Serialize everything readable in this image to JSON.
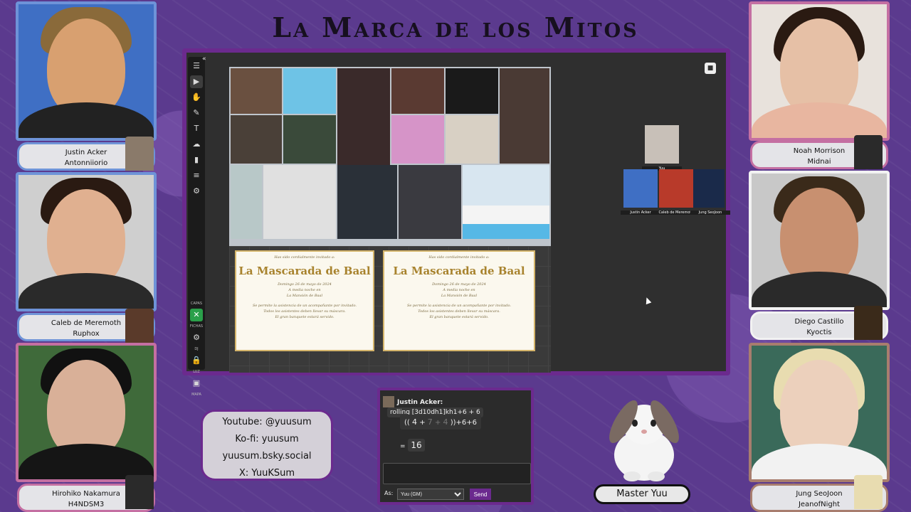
{
  "title": "La Marca de los Mitos",
  "players": [
    {
      "name": "Justin Acker",
      "handle": "Antonniiorio"
    },
    {
      "name": "Caleb de Meremoth",
      "handle": "Ruphox"
    },
    {
      "name": "Hirohiko Nakamura",
      "handle": "H4NDSM3"
    },
    {
      "name": "Noah Morrison",
      "handle": "Midnai"
    },
    {
      "name": "Diego Castillo",
      "handle": "Kyoctis"
    },
    {
      "name": "Jung SeoJoon",
      "handle": "JeanofNight"
    }
  ],
  "toolbar": {
    "labels": [
      "CAPAS",
      "FICHAS",
      "DJ",
      "LUZ",
      "MAPA"
    ],
    "icons": [
      "menu-icon",
      "pointer-icon",
      "hand-icon",
      "brush-icon",
      "text-icon",
      "fog-icon",
      "ruler-icon",
      "notes-icon",
      "settings-icon"
    ]
  },
  "invites": [
    {
      "intro": "Has sido cordialmente invitado a:",
      "title": "La Mascarada de Baal",
      "date": "Domingo 26 de mayo de 2024",
      "time": "A media noche en",
      "place": "La Mansión de Baal",
      "rule1": "Se permite la asistencia de un acompañante por invitado.",
      "rule2": "Todos los asistentes deben llevar su máscara.",
      "rule3": "El gran banquete estará servido."
    },
    {
      "intro": "Has sido cordialmente invitado a:",
      "title": "La Mascarada de Baal",
      "date": "Domingo 26 de mayo de 2024",
      "time": "A media noche en",
      "place": "La Mansión de Baal",
      "rule1": "Se permite la asistencia de un acompañante por invitado.",
      "rule2": "Todos los asistentes deben llevar su máscara.",
      "rule3": "El gran banquete estará servido."
    }
  ],
  "tokens": {
    "gm": "Yuu",
    "players": [
      "Justin Acker",
      "Caleb de Meremoth",
      "Jung SeoJoon"
    ]
  },
  "socials": {
    "youtube": "Youtube: @yuusum",
    "kofi": "Ko-fi: yuusum",
    "bsky": "yuusum.bsky.social",
    "x": "X: YuuKSum"
  },
  "chat": {
    "speaker": "Justin Acker:",
    "command": "rolling [3d10dh1]kh1+6 + 6",
    "roll_open": "((",
    "die1": "4",
    "plus1": "+",
    "die2": "7",
    "plus2": "+",
    "die3": "4",
    "roll_close": "))+6+6",
    "equals": "=",
    "result": "16",
    "as_label": "As:",
    "as_value": "Yuu (GM)",
    "send": "Send"
  },
  "host": {
    "name": "Master Yuu"
  },
  "colors": {
    "background": "#5b3a8e",
    "frame": "#6b2a8e",
    "blue_border": "#6e93d8",
    "pink_border": "#c46fa2"
  }
}
